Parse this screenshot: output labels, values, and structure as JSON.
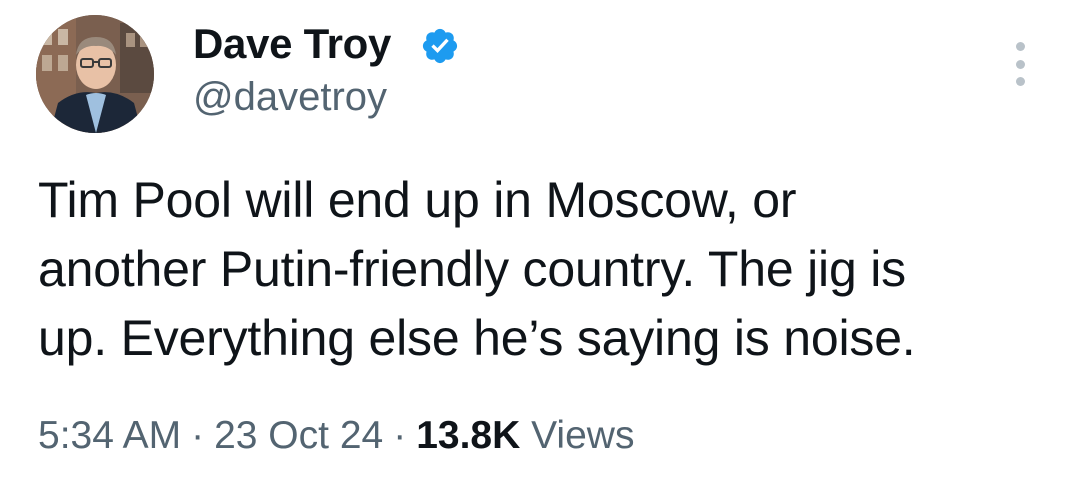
{
  "tweet": {
    "author": {
      "display_name": "Dave Troy",
      "handle": "@davetroy",
      "verified": true,
      "verified_color": "#1d9bf0",
      "avatar_icon": "profile-photo"
    },
    "more_icon": "more-options-vertical-dots",
    "text_lines": [
      "Tim Pool will end up in Moscow, or",
      "another Putin-friendly country. The jig is",
      "up. Everything else he’s saying is noise."
    ],
    "meta": {
      "time": "5:34 AM",
      "separator": "·",
      "date": "23 Oct 24",
      "views_count": "13.8K",
      "views_label": "Views"
    }
  }
}
